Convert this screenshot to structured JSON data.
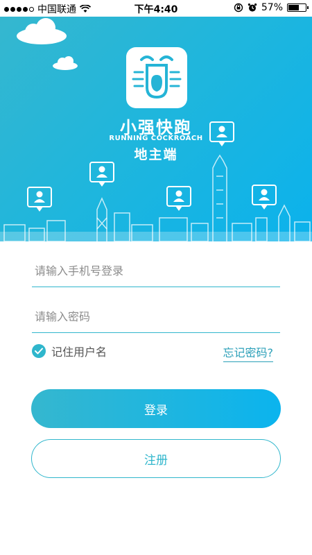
{
  "status_bar": {
    "carrier": "中国联通",
    "time": "下午4:40",
    "battery_percent_label": "57%",
    "battery_level": 0.57,
    "icons": [
      "signal-icon",
      "wifi-icon",
      "rotation-lock-icon",
      "alarm-icon",
      "battery-icon"
    ]
  },
  "hero": {
    "brand_name": "小强快跑",
    "brand_subtitle": "RUNNING COCKROACH",
    "role": "地主端",
    "colors": {
      "gradient_start": "#35b7cf",
      "gradient_end": "#0bb2ec"
    }
  },
  "form": {
    "phone_placeholder": "请输入手机号登录",
    "phone_value": "",
    "password_placeholder": "请输入密码",
    "password_value": "",
    "remember_label": "记住用户名",
    "remember_checked": true,
    "forgot_label": "忘记密码?"
  },
  "actions": {
    "login_label": "登录",
    "register_label": "注册",
    "accent": "#2fb6cc"
  }
}
